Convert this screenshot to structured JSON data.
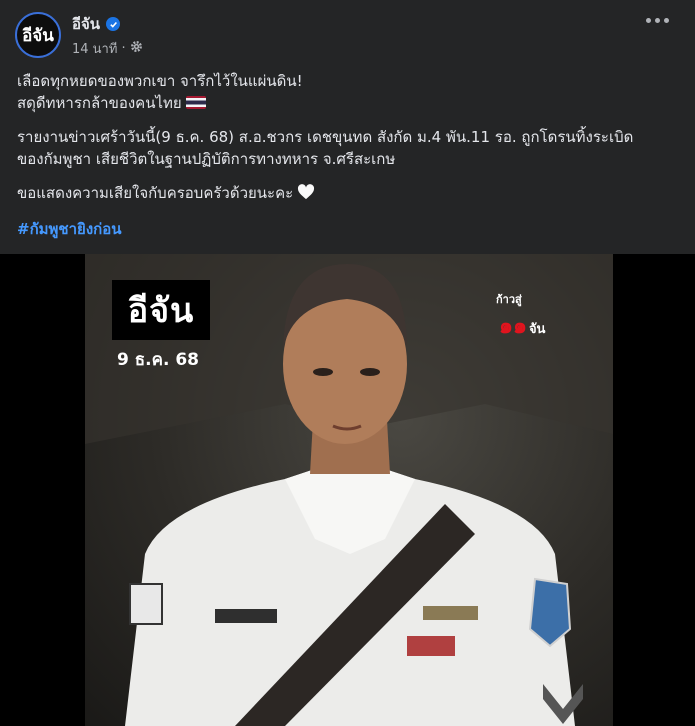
{
  "post": {
    "avatar_text": "อีจัน",
    "page_name": "อีจัน",
    "timestamp": "14 นาที",
    "meta_separator": "·",
    "lines": [
      "เลือดทุกหยดของพวกเขา จารึกไว้ในแผ่นดิน!",
      "สดุดีทหารกล้าของคนไทย",
      "รายงานข่าวเศร้าวันนี้(9 ธ.ค. 68) ส.อ.ชวกร เดชขุนทด สังกัด ม.4 พัน.11 รอ. ถูกโดรนทิ้งระเบิด",
      "ของกัมพูชา เสียชีวิตในฐานปฏิบัติการทางทหาร จ.ศรีสะเกษ",
      "ขอแสดงความเสียใจกับครอบครัวด้วยนะคะ"
    ],
    "hashtag": "#กัมพูชายิงก่อน"
  },
  "image": {
    "logo_text": "อีจัน",
    "date_text": "9 ธ.ค. 68",
    "brand_small": "ก้าวสู่",
    "brand_number": "๑๑",
    "brand_suffix": "จัน"
  },
  "icons": [
    "verified-badge-icon",
    "privacy-gear-icon",
    "more-options-icon",
    "thai-flag-emoji",
    "white-heart-emoji"
  ],
  "colors": {
    "background": "#242526",
    "text": "#e4e6eb",
    "secondary_text": "#b0b3b8",
    "hashtag": "#4599ff",
    "verified": "#1b74e4"
  }
}
